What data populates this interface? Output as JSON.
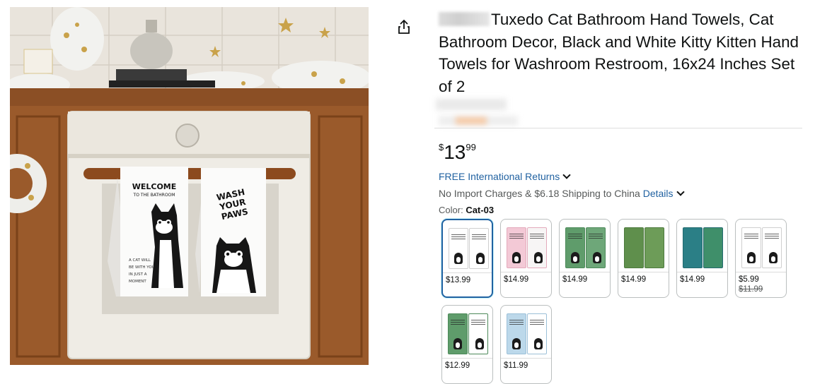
{
  "product": {
    "title": "Tuxedo Cat Bathroom Hand Towels, Cat Bathroom Decor, Black and White Kitty Kitten Hand Towels for Washroom Restroom, 16x24 Inches Set of 2",
    "image_text": {
      "towel1_heading": "WELCOME",
      "towel1_sub": "TO THE BATHROOM",
      "towel1_foot": [
        "A CAT WILL",
        "BE WITH YOU",
        "IN JUST A",
        "MOMENT"
      ],
      "towel2_heading": [
        "WASH",
        "YOUR",
        "PAWS"
      ]
    }
  },
  "price": {
    "symbol": "$",
    "whole": "13",
    "fraction": "99"
  },
  "delivery": {
    "returns_link": "FREE International Returns",
    "shipping_text": "No Import Charges & $6.18 Shipping to China",
    "details_link": "Details"
  },
  "variant": {
    "label": "Color:",
    "selected": "Cat-03"
  },
  "swatches": [
    {
      "price": "$13.99",
      "scheme": "white",
      "selected": true
    },
    {
      "price": "$14.99",
      "scheme": "pink"
    },
    {
      "price": "$14.99",
      "scheme": "green"
    },
    {
      "price": "$14.99",
      "scheme": "green-pattern"
    },
    {
      "price": "$14.99",
      "scheme": "teal-pattern"
    },
    {
      "price": "$5.99",
      "old_price": "$11.99",
      "scheme": "white-walking"
    },
    {
      "price": "$12.99",
      "scheme": "green-wash"
    },
    {
      "price": "$11.99",
      "scheme": "blue"
    }
  ],
  "colors": {
    "link": "#2162a1",
    "selected_border": "#2162a1",
    "text": "#0f1111",
    "muted": "#565959"
  }
}
